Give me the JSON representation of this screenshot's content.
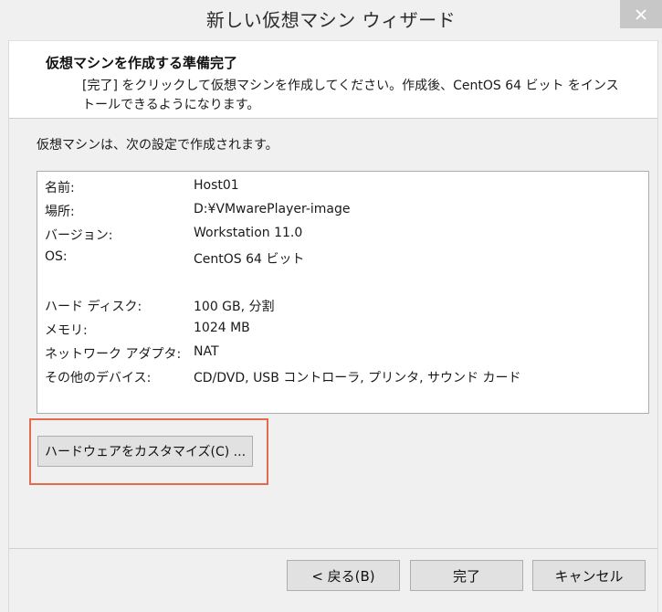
{
  "window": {
    "title": "新しい仮想マシン ウィザード",
    "close_icon": "close-icon"
  },
  "header": {
    "title": "仮想マシンを作成する準備完了",
    "description": "[完了] をクリックして仮想マシンを作成してください。作成後、CentOS 64 ビット をインストールできるようになります。"
  },
  "main": {
    "intro": "仮想マシンは、次の設定で作成されます。",
    "summary": [
      {
        "label": "名前:",
        "value": "Host01"
      },
      {
        "label": "場所:",
        "value": "D:¥VMwarePlayer-image"
      },
      {
        "label": "バージョン:",
        "value": "Workstation 11.0"
      },
      {
        "label": "OS:",
        "value": "CentOS 64 ビット"
      },
      {
        "label": "ハード ディスク:",
        "value": "100 GB, 分割"
      },
      {
        "label": "メモリ:",
        "value": "1024 MB"
      },
      {
        "label": "ネットワーク アダプタ:",
        "value": "NAT"
      },
      {
        "label": "その他のデバイス:",
        "value": "CD/DVD, USB コントローラ, プリンタ, サウンド カード"
      }
    ],
    "customize_button": "ハードウェアをカスタマイズ(C) ..."
  },
  "footer": {
    "back_label": "< 戻る(B)",
    "finish_label": "完了",
    "cancel_label": "キャンセル"
  },
  "colors": {
    "highlight": "#e06c4d",
    "window_bg": "#f0f0f0"
  }
}
